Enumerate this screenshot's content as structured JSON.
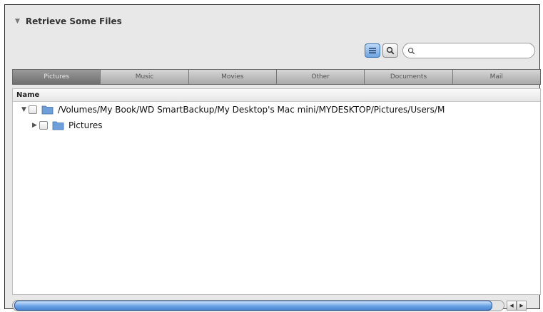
{
  "panel": {
    "title": "Retrieve Some Files"
  },
  "toolbar": {
    "list_view_icon": "list-view-icon",
    "search_toggle_icon": "magnifier-icon",
    "search_placeholder": ""
  },
  "tabs": [
    {
      "label": "Pictures",
      "selected": true
    },
    {
      "label": "Music",
      "selected": false
    },
    {
      "label": "Movies",
      "selected": false
    },
    {
      "label": "Other",
      "selected": false
    },
    {
      "label": "Documents",
      "selected": false
    },
    {
      "label": "Mail",
      "selected": false
    }
  ],
  "file_list": {
    "column_header": "Name",
    "rows": [
      {
        "label": "/Volumes/My Book/WD SmartBackup/My Desktop's Mac mini/MYDESKTOP/Pictures/Users/M",
        "expanded": true
      },
      {
        "label": "Pictures",
        "expanded": false
      }
    ]
  },
  "scrollbar": {
    "thumb_fraction": 0.98
  },
  "colors": {
    "accent": "#6aa3e4",
    "folder": "#6f9fd8",
    "tab_selected": "#7e7e7e"
  }
}
